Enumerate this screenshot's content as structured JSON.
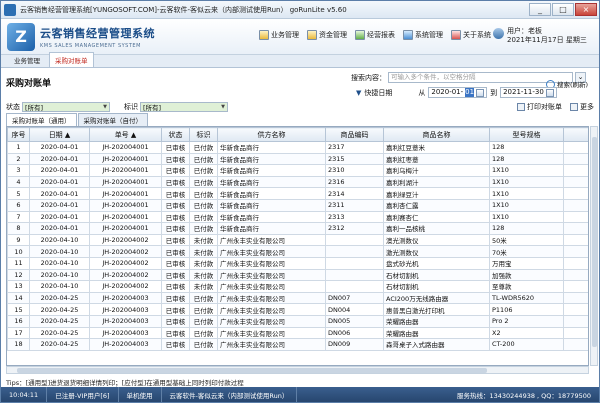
{
  "window": {
    "title": "云客销售经营管理系统[YUNGOSOFT.COM]-云客软件-客似云来（内部测试使用Run）  goRunLite v5.60",
    "controls": [
      "_",
      "□",
      "×"
    ]
  },
  "header": {
    "brand_cn": "云客销售经营管理系统",
    "brand_en": "KMS SALES MANAGEMENT SYSTEM",
    "nav": [
      "业务管理",
      "资金管理",
      "经营报表",
      "系统管理",
      "关于系统"
    ],
    "user_label": "用户：老板",
    "date": "2021年11月17日 星期三"
  },
  "tabs": [
    "业务管理",
    "采购对账单"
  ],
  "page": {
    "title": "采购对账单",
    "search_label": "搜索内容：",
    "search_placeholder": "可输入多个条件，以空格分隔",
    "refresh": "搜索(刷新)",
    "quick_date": "快捷日期",
    "from_label": "从",
    "date_from_main": "2020-01-",
    "date_from_sel": "01",
    "to_label": "到",
    "date_to": "2021-11-30",
    "status_label": "状态",
    "status_value": "[所有]",
    "mark_label": "标识",
    "mark_value": "[所有]",
    "print": "打印对账单",
    "more": "更多",
    "subtabs": [
      "采购对账单（通用）",
      "采购对账单（自付）"
    ]
  },
  "table": {
    "headers": [
      "序号",
      "日期 ▲",
      "单号 ▲",
      "状态",
      "标识",
      "供方名称",
      "商品编码",
      "商品名称",
      "型号规格",
      "单位"
    ],
    "rows": [
      [
        "1",
        "2020-04-01",
        "JH-202004001",
        "已审核",
        "已付款",
        "华新食品商行",
        "2317",
        "嘉利红豆薏米",
        "128",
        "箱"
      ],
      [
        "2",
        "2020-04-01",
        "JH-202004001",
        "已审核",
        "已付款",
        "华新食品商行",
        "2315",
        "嘉利红枣薏",
        "128",
        "箱"
      ],
      [
        "3",
        "2020-04-01",
        "JH-202004001",
        "已审核",
        "已付款",
        "华新食品商行",
        "2310",
        "嘉利乌梅汁",
        "1X10",
        "箱"
      ],
      [
        "4",
        "2020-04-01",
        "JH-202004001",
        "已审核",
        "已付款",
        "华新食品商行",
        "2316",
        "嘉利利湖汁",
        "1X10",
        "箱"
      ],
      [
        "5",
        "2020-04-01",
        "JH-202004001",
        "已审核",
        "已付款",
        "华新食品商行",
        "2314",
        "嘉利绿豆汁",
        "1X10",
        "箱"
      ],
      [
        "6",
        "2020-04-01",
        "JH-202004001",
        "已审核",
        "已付款",
        "华新食品商行",
        "2311",
        "嘉利杏仁露",
        "1X10",
        "箱"
      ],
      [
        "7",
        "2020-04-01",
        "JH-202004001",
        "已审核",
        "已付款",
        "华新食品商行",
        "2313",
        "嘉利赛杏仁",
        "1X10",
        "箱"
      ],
      [
        "8",
        "2020-04-01",
        "JH-202004001",
        "已审核",
        "已付款",
        "华新食品商行",
        "2312",
        "嘉利一品核桃",
        "128",
        "箱"
      ],
      [
        "9",
        "2020-04-10",
        "JH-202004002",
        "已审核",
        "未付款",
        "广州永丰实业有限公司",
        "",
        "澳光测数仪",
        "50米",
        "件"
      ],
      [
        "10",
        "2020-04-10",
        "JH-202004002",
        "已审核",
        "未付款",
        "广州永丰实业有限公司",
        "",
        "激光测数仪",
        "70米",
        "件"
      ],
      [
        "11",
        "2020-04-10",
        "JH-202004002",
        "已审核",
        "未付款",
        "广州永丰实业有限公司",
        "",
        "盘式砂光机",
        "万用宝",
        "件"
      ],
      [
        "12",
        "2020-04-10",
        "JH-202004002",
        "已审核",
        "未付款",
        "广州永丰实业有限公司",
        "",
        "石材切割机",
        "加强款",
        "件"
      ],
      [
        "13",
        "2020-04-10",
        "JH-202004002",
        "已审核",
        "未付款",
        "广州永丰实业有限公司",
        "",
        "石材切割机",
        "至尊款",
        "件"
      ],
      [
        "14",
        "2020-04-25",
        "JH-202004003",
        "已审核",
        "已付款",
        "广州永丰实业有限公司",
        "DN007",
        "ACI200万无线路由器",
        "TL-WDR5620",
        "台"
      ],
      [
        "15",
        "2020-04-25",
        "JH-202004003",
        "已审核",
        "已付款",
        "广州永丰实业有限公司",
        "DN004",
        "惠普黑白激光打印机",
        "P1106",
        "台"
      ],
      [
        "16",
        "2020-04-25",
        "JH-202004003",
        "已审核",
        "已付款",
        "广州永丰实业有限公司",
        "DN005",
        "荣耀路由器",
        "Pro 2",
        "台"
      ],
      [
        "17",
        "2020-04-25",
        "JH-202004003",
        "已审核",
        "已付款",
        "广州永丰实业有限公司",
        "DN006",
        "荣耀路由器",
        "X2",
        "台"
      ],
      [
        "18",
        "2020-04-25",
        "JH-202004003",
        "已审核",
        "已付款",
        "广州永丰实业有限公司",
        "DN009",
        "森哥桌子入式路由器",
        "CT-200",
        "台"
      ]
    ]
  },
  "tips": "Tips：[通用型]进货退货明细详情列印；[应付型]在通用型基础上同时列印付款过程",
  "status": {
    "time": "10:04:11",
    "edition": "已注册-VIP用户[6]",
    "mode": "单机使用",
    "center": "云客软件-客似云来（内部测试使用Run）",
    "service": "服务热线：13430244938 , QQ：18779500"
  }
}
